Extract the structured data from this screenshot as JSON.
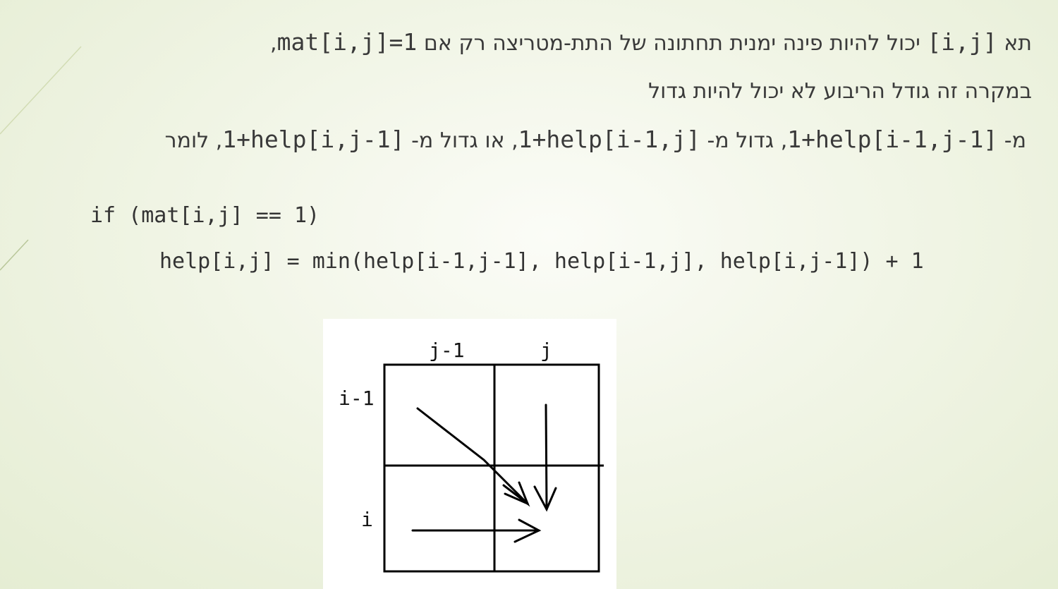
{
  "slide": {
    "line1": {
      "prefix": "תא",
      "cell": "[i,j]",
      "middle": "יכול להיות פינה ימנית תחתונה של התת-מטריצה רק אם",
      "condition": "mat[i,j]=1",
      "suffix": ","
    },
    "line2": "במקרה זה גודל הריבוע לא יכול להיות גדול",
    "line3": {
      "p1": "מ-",
      "e1": "1+help[i-1,j-1]",
      "p2": ", גדול מ-",
      "e2": "1+help[i-1,j]",
      "p3": ", או גדול מ-",
      "e3": "1+help[i,j-1]",
      "p4": ",   לומר"
    },
    "code": {
      "line1": "if (mat[i,j] == 1)",
      "line2": "help[i,j] = min(help[i-1,j-1], help[i-1,j], help[i,j-1]) + 1"
    }
  },
  "diagram": {
    "col_labels": [
      "j-1",
      "j"
    ],
    "row_labels": [
      "i-1",
      "i"
    ]
  }
}
